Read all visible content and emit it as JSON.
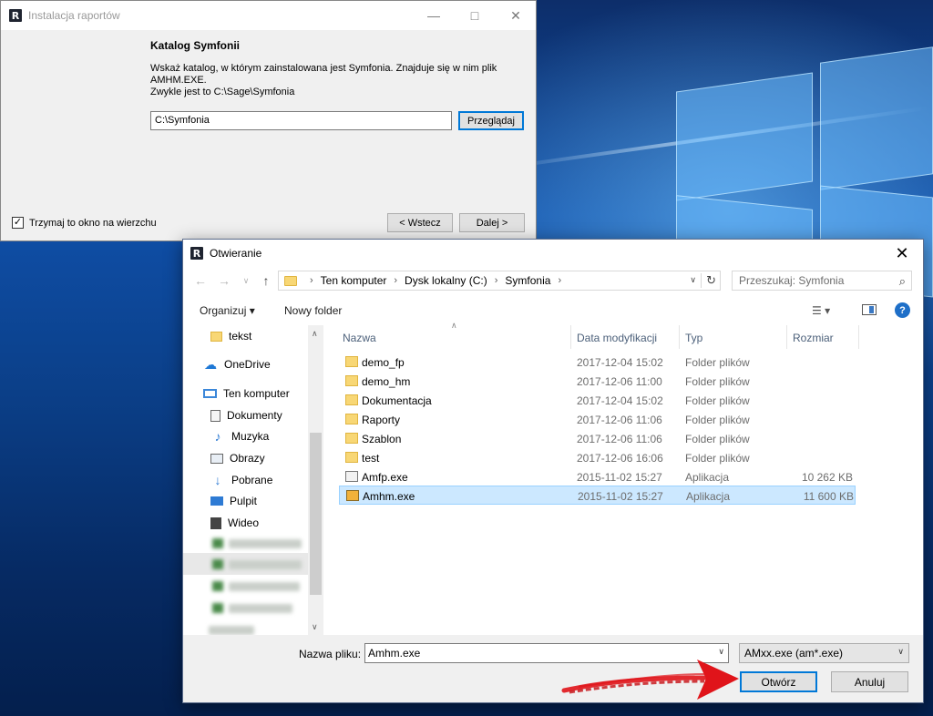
{
  "installer": {
    "title": "Instalacja raportów",
    "heading": "Katalog Symfonii",
    "description_line1": "Wskaż katalog, w którym zainstalowana jest Symfonia. Znajduje się w nim plik",
    "description_line2": "AMHM.EXE.",
    "description_line3": "Zwykle jest to C:\\Sage\\Symfonia",
    "path_value": "C:\\Symfonia",
    "browse_label": "Przeglądaj",
    "keep_on_top_label": "Trzymaj to okno na wierzchu",
    "keep_on_top_checked": true,
    "back_label": "< Wstecz",
    "next_label": "Dalej >"
  },
  "dialog": {
    "title": "Otwieranie",
    "breadcrumb": [
      "Ten komputer",
      "Dysk lokalny (C:)",
      "Symfonia"
    ],
    "search_placeholder": "Przeszukaj: Symfonia",
    "organize_label": "Organizuj ▾",
    "new_folder_label": "Nowy folder",
    "nav_items": [
      {
        "label": "tekst",
        "icon": "folder-icon"
      },
      {
        "label": "OneDrive",
        "icon": "onedrive-icon"
      },
      {
        "label": "Ten komputer",
        "icon": "computer-icon"
      },
      {
        "label": "Dokumenty",
        "icon": "documents-icon"
      },
      {
        "label": "Muzyka",
        "icon": "music-icon"
      },
      {
        "label": "Obrazy",
        "icon": "pictures-icon"
      },
      {
        "label": "Pobrane",
        "icon": "downloads-icon"
      },
      {
        "label": "Pulpit",
        "icon": "desktop-icon"
      },
      {
        "label": "Wideo",
        "icon": "video-icon"
      }
    ],
    "columns": {
      "name": "Nazwa",
      "date": "Data modyfikacji",
      "type": "Typ",
      "size": "Rozmiar"
    },
    "files": [
      {
        "name": "demo_fp",
        "date": "2017-12-04 15:02",
        "type": "Folder plików",
        "size": "",
        "kind": "folder"
      },
      {
        "name": "demo_hm",
        "date": "2017-12-06 11:00",
        "type": "Folder plików",
        "size": "",
        "kind": "folder"
      },
      {
        "name": "Dokumentacja",
        "date": "2017-12-04 15:02",
        "type": "Folder plików",
        "size": "",
        "kind": "folder"
      },
      {
        "name": "Raporty",
        "date": "2017-12-06 11:06",
        "type": "Folder plików",
        "size": "",
        "kind": "folder"
      },
      {
        "name": "Szablon",
        "date": "2017-12-06 11:06",
        "type": "Folder plików",
        "size": "",
        "kind": "folder"
      },
      {
        "name": "test",
        "date": "2017-12-06 16:06",
        "type": "Folder plików",
        "size": "",
        "kind": "folder"
      },
      {
        "name": "Amfp.exe",
        "date": "2015-11-02 15:27",
        "type": "Aplikacja",
        "size": "10 262 KB",
        "kind": "exe"
      },
      {
        "name": "Amhm.exe",
        "date": "2015-11-02 15:27",
        "type": "Aplikacja",
        "size": "11 600 KB",
        "kind": "exe",
        "selected": true
      }
    ],
    "filename_label": "Nazwa pliku:",
    "filename_value": "Amhm.exe",
    "filter_value": "AMxx.exe (am*.exe)",
    "open_label": "Otwórz",
    "cancel_label": "Anuluj"
  },
  "colors": {
    "accent": "#0078d7",
    "selection": "#cce8ff",
    "annotation_arrow": "#e0141a"
  }
}
